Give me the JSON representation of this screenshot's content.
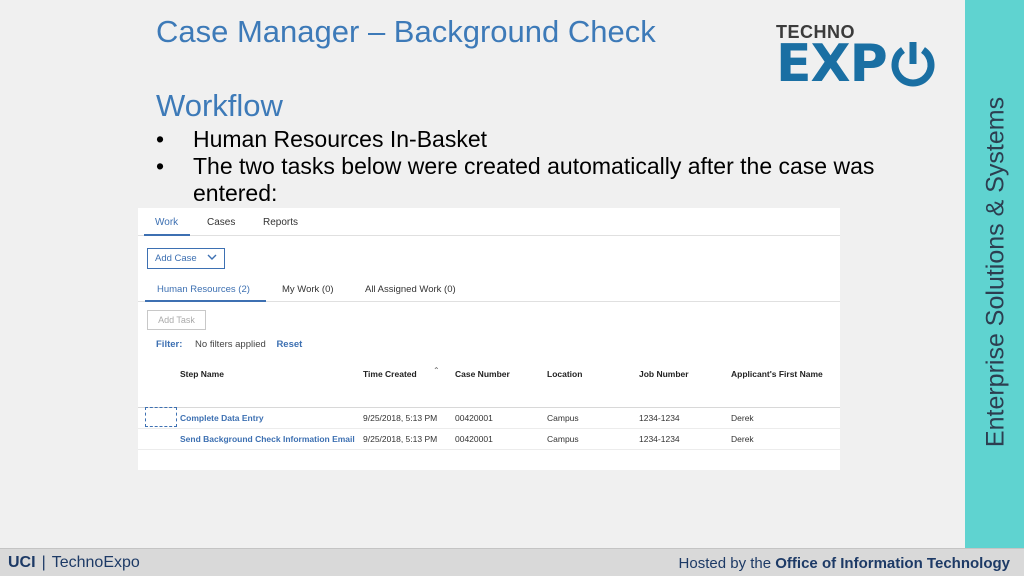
{
  "slide": {
    "title": "Case Manager – Background Check",
    "subheading": "Workflow",
    "bullets": [
      "Human Resources In-Basket",
      "The two tasks below were created automatically after the case was entered:"
    ],
    "bullet_glyph": "•",
    "side_text": "Enterprise Solutions & Systems",
    "side_color": "#5fd3d0"
  },
  "logo": {
    "top": "TECHNO",
    "main": "EXP"
  },
  "app": {
    "nav_tabs": [
      "Work",
      "Cases",
      "Reports"
    ],
    "add_case_label": "Add Case",
    "subtabs": [
      "Human Resources (2)",
      "My Work (0)",
      "All Assigned Work (0)"
    ],
    "add_task_label": "Add Task",
    "filter": {
      "label": "Filter:",
      "value": "No filters applied",
      "reset": "Reset"
    },
    "columns": [
      "Step Name",
      "Time Created",
      "Case Number",
      "Location",
      "Job Number",
      "Applicant's First Name"
    ],
    "rows": [
      [
        "Complete Data Entry",
        "9/25/2018, 5:13 PM",
        "00420001",
        "Campus",
        "1234-1234",
        "Derek"
      ],
      [
        "Send Background Check Information Email",
        "9/25/2018, 5:13 PM",
        "00420001",
        "Campus",
        "1234-1234",
        "Derek"
      ]
    ],
    "accent_color": "#3d70b2"
  },
  "footer": {
    "uci": "UCI",
    "separator": "|",
    "org": "TechnoExpo",
    "hosted_prefix": "Hosted by the",
    "hosted_org": "Office of Information Technology"
  }
}
